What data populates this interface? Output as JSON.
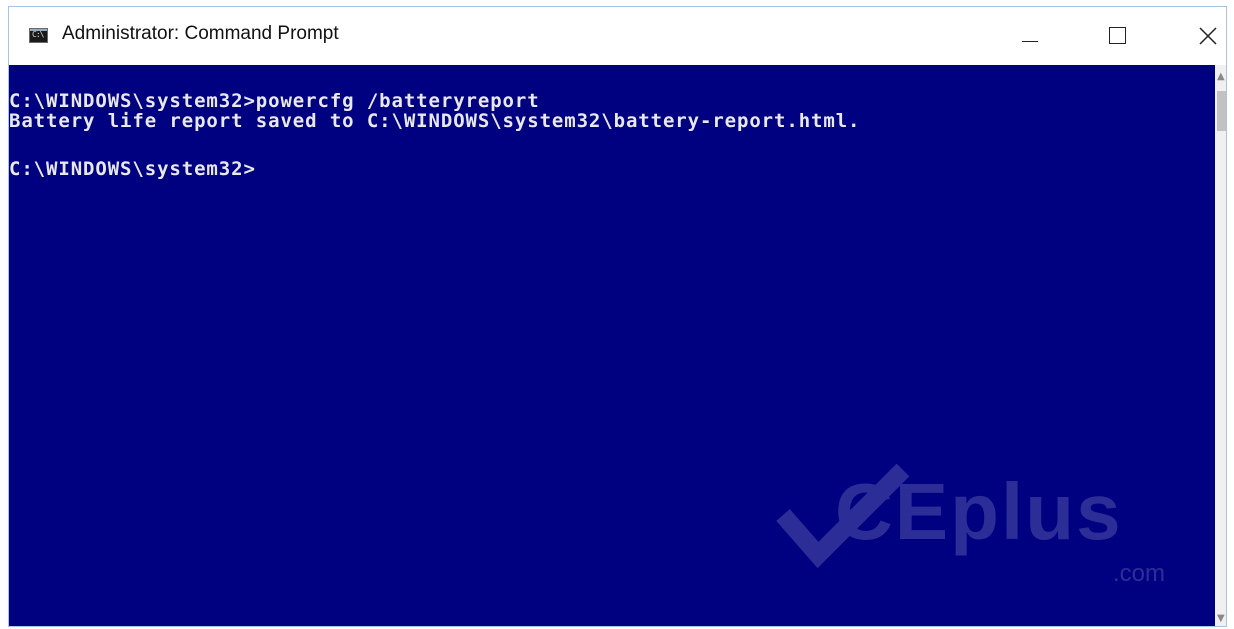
{
  "window": {
    "title": "Administrator: Command Prompt",
    "icon": "cmd-icon",
    "icon_label": "C:\\",
    "controls": {
      "minimize": "minimize-icon",
      "maximize": "maximize-icon",
      "close": "close-icon"
    }
  },
  "console": {
    "background": "#000180",
    "foreground": "#e8e8ee",
    "lines": [
      "C:\\WINDOWS\\system32>powercfg /batteryreport",
      "Battery life report saved to C:\\WINDOWS\\system32\\battery-report.html.",
      "C:\\WINDOWS\\system32>"
    ]
  },
  "watermark": {
    "text": "CEplus",
    "subtext": ".com"
  }
}
